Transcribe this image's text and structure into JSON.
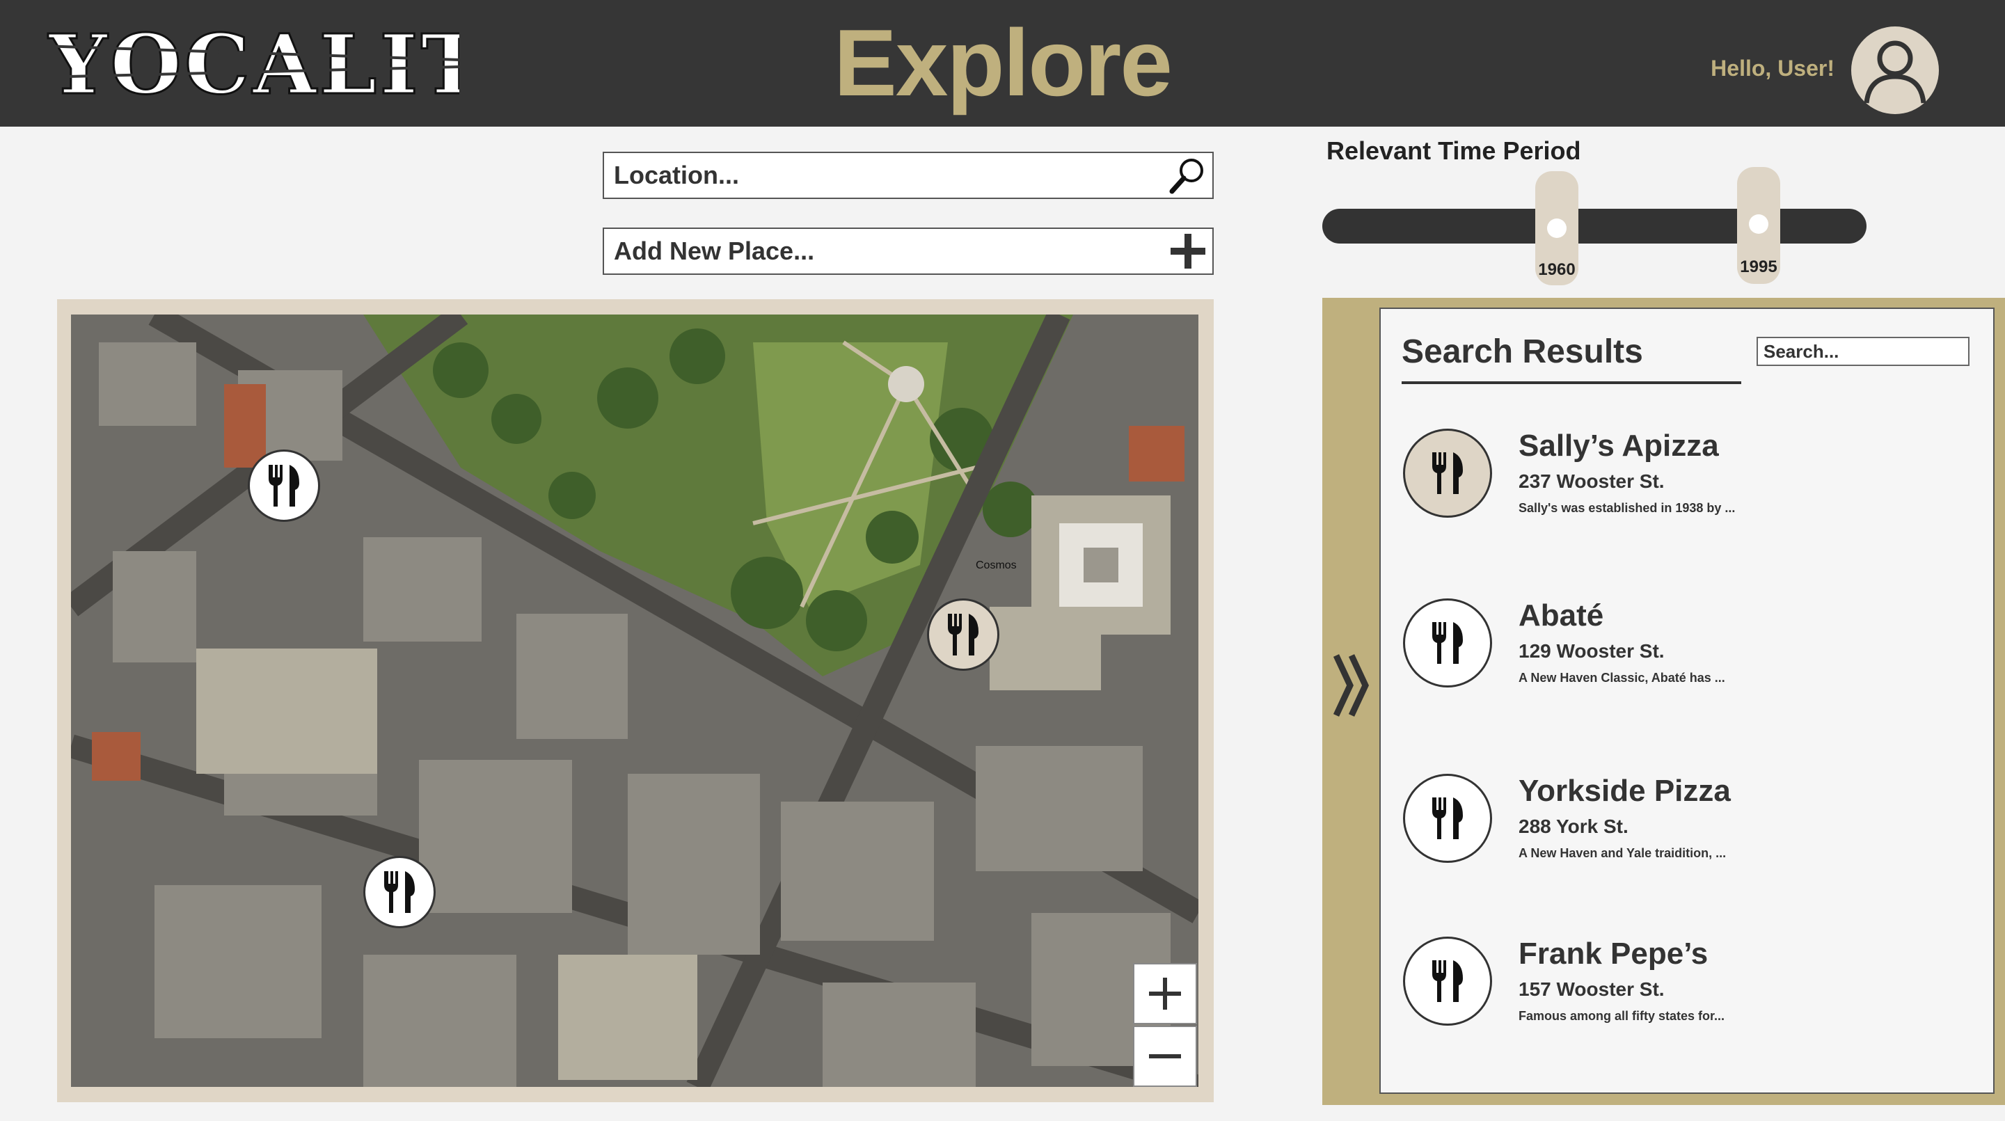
{
  "header": {
    "logo_text": "YOCALITY",
    "title": "Explore",
    "greeting": "Hello, User!",
    "avatar_icon": "user-icon"
  },
  "location_input": {
    "placeholder": "Location...",
    "icon": "magnifier-icon"
  },
  "add_place_input": {
    "placeholder": "Add New Place...",
    "icon": "plus-icon"
  },
  "time_period": {
    "title": "Relevant Time Period",
    "start_year": "1960",
    "end_year": "1995"
  },
  "map": {
    "pins": [
      {
        "icon": "fork-knife-icon",
        "selected": false
      },
      {
        "icon": "fork-knife-icon",
        "selected": true
      },
      {
        "icon": "fork-knife-icon",
        "selected": false
      }
    ],
    "zoom_in_icon": "plus-icon",
    "zoom_out_icon": "minus-icon",
    "tiny_label": "Cosmos"
  },
  "results": {
    "title": "Search Results",
    "search_placeholder": "Search...",
    "collapse_icon": "double-chevron-right-icon",
    "items": [
      {
        "name": "Sally’s Apizza",
        "address": "237 Wooster St.",
        "description": "Sally's was established in 1938 by ...",
        "selected": true
      },
      {
        "name": "Abaté",
        "address": "129 Wooster St.",
        "description": "A New Haven Classic, Abaté has ...",
        "selected": false
      },
      {
        "name": "Yorkside Pizza",
        "address": "288 York St.",
        "description": "A New Haven and Yale traidition, ...",
        "selected": false
      },
      {
        "name": "Frank Pepe’s",
        "address": "157 Wooster St.",
        "description": "Famous among all fifty states for...",
        "selected": false
      }
    ]
  },
  "colors": {
    "header_bg": "#363636",
    "accent_gold": "#bfb07e",
    "beige": "#ded5c6",
    "page_bg": "#f3f3f3"
  }
}
